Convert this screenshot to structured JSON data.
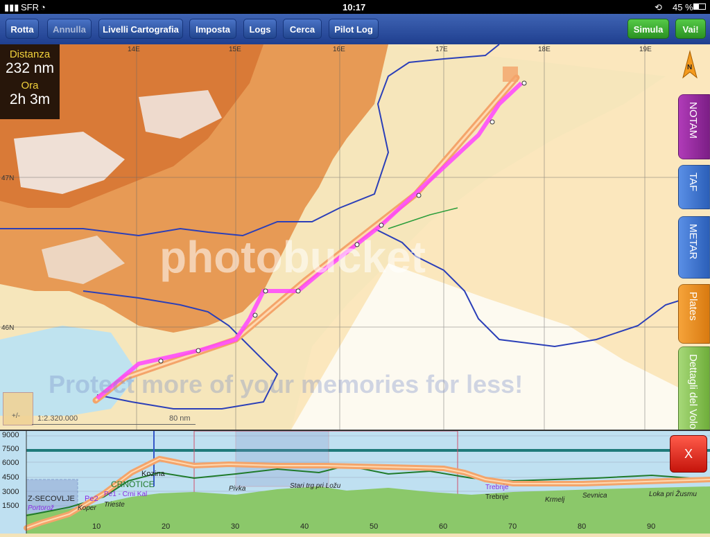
{
  "status": {
    "carrier": "SFR",
    "time": "10:17",
    "battery": "45 %"
  },
  "toolbar": {
    "rotta": "Rotta",
    "annulla": "Annulla",
    "livelli": "Livelli Cartografia",
    "imposta": "Imposta",
    "logs": "Logs",
    "cerca": "Cerca",
    "pilot_log": "Pilot Log",
    "simula": "Simula",
    "vai": "Vai!"
  },
  "info": {
    "distance_label": "Distanza",
    "distance_value": "232 nm",
    "time_label": "Ora",
    "time_value": "2h 3m"
  },
  "map": {
    "longitudes": [
      "14E",
      "15E",
      "16E",
      "17E",
      "18E",
      "19E"
    ],
    "latitudes": [
      "47N",
      "46N"
    ],
    "north_label": "N",
    "scale_ratio": "1:2.320.000",
    "scale_distance": "80 nm",
    "scale_button": "+/-"
  },
  "side_tabs": {
    "notam": "NOTAM",
    "taf": "TAF",
    "metar": "METAR",
    "plates": "Plates",
    "dettagli": "Dettagli del Volo"
  },
  "watermark": {
    "logo": "photobucket",
    "promo": "Protect more of your memories for less!"
  },
  "profile": {
    "y_ticks": [
      "9000",
      "7500",
      "6000",
      "4500",
      "3000",
      "1500"
    ],
    "x_ticks": [
      "10",
      "20",
      "30",
      "40",
      "50",
      "60",
      "70",
      "80",
      "90"
    ],
    "labels": {
      "kozina": "Kozina",
      "crnotice": "CRNOTICE",
      "pivka": "Pivka",
      "stari_trg": "Stari trg pri Ložu",
      "trebnje_purple": "Trebnje",
      "trebnje": "Trebnje",
      "krmelj": "Krmelj",
      "sevnica": "Sevnica",
      "loka": "Loka pri Žusmu",
      "pe1": "Pe1 - Crni Kal",
      "pe2": "Pe2",
      "trieste": "Trieste",
      "koper": "Koper",
      "sec": "Z-SECOVLJE",
      "portoroz": "Portorož"
    },
    "close": "X"
  },
  "colors": {
    "route": "#ff44ff",
    "track": "#f4a46a",
    "border": "#2b3fb8",
    "toolbar": "#2a4c9e",
    "terrain_green": "#8bc86a"
  }
}
